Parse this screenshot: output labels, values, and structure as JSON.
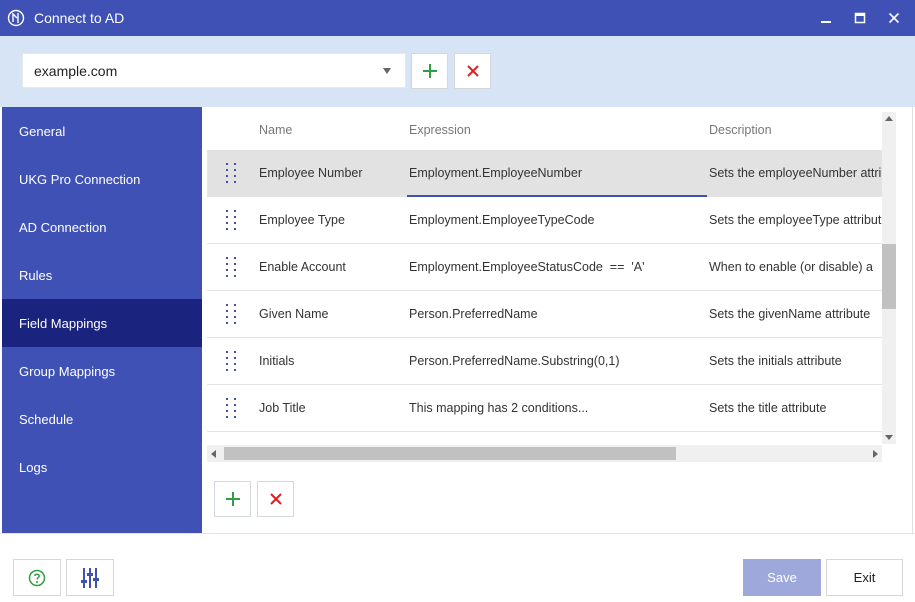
{
  "window": {
    "title": "Connect to AD"
  },
  "domain": {
    "selected": "example.com"
  },
  "sidebar": {
    "items": [
      {
        "label": "General"
      },
      {
        "label": "UKG Pro Connection"
      },
      {
        "label": "AD Connection"
      },
      {
        "label": "Rules"
      },
      {
        "label": "Field Mappings"
      },
      {
        "label": "Group Mappings"
      },
      {
        "label": "Schedule"
      },
      {
        "label": "Logs"
      }
    ],
    "active_index": 4
  },
  "grid": {
    "headers": {
      "name": "Name",
      "expression": "Expression",
      "description": "Description"
    },
    "rows": [
      {
        "name": "Employee Number",
        "expression": "Employment.EmployeeNumber",
        "description": "Sets the employeeNumber attribute"
      },
      {
        "name": "Employee Type",
        "expression": "Employment.EmployeeTypeCode",
        "description": "Sets the employeeType attribute"
      },
      {
        "name": "Enable Account",
        "expression": "Employment.EmployeeStatusCode  ==  'A'",
        "description": "When to enable (or disable) a"
      },
      {
        "name": "Given Name",
        "expression": "Person.PreferredName",
        "description": "Sets the givenName attribute"
      },
      {
        "name": "Initials",
        "expression": "Person.PreferredName.Substring(0,1)",
        "description": "Sets the initials attribute"
      },
      {
        "name": "Job Title",
        "expression": "This mapping has 2 conditions...",
        "description": "Sets the title attribute"
      }
    ],
    "selected_index": 0
  },
  "footer": {
    "save_label": "Save",
    "exit_label": "Exit"
  },
  "colors": {
    "primary": "#3f51b5",
    "sidebar_active": "#1a237e",
    "add_green": "#2ea043",
    "delete_red": "#e02020",
    "save_disabled": "#9fa8da"
  }
}
